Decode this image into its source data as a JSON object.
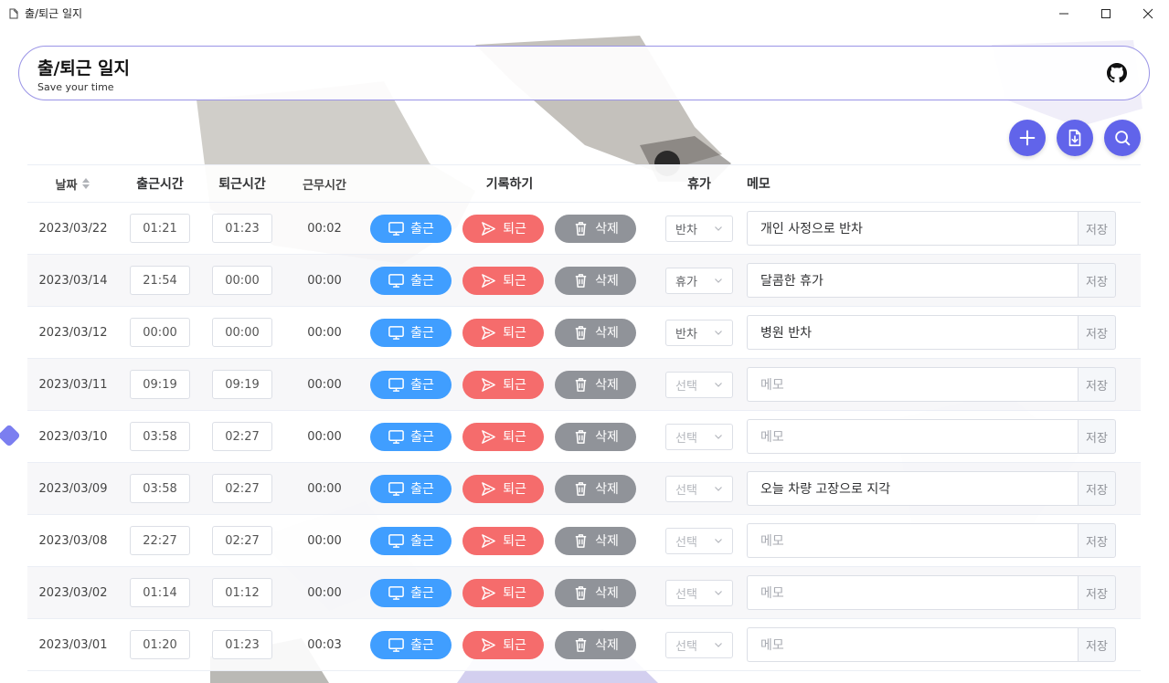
{
  "window": {
    "title": "출/퇴근 일지"
  },
  "header": {
    "title": "출/퇴근 일지",
    "subtitle": "Save your time"
  },
  "actions": {
    "add": "plus-icon",
    "export": "file-download-icon",
    "search": "search-icon"
  },
  "colors": {
    "accent": "#6164ea",
    "clock_in": "#409eff",
    "clock_out": "#f56c6c",
    "delete": "#909399"
  },
  "table": {
    "headers": {
      "date": "날짜",
      "clock_in": "출근시간",
      "clock_out": "퇴근시간",
      "work": "근무시간",
      "record": "기록하기",
      "leave": "휴가",
      "memo": "메모"
    },
    "labels": {
      "clock_in": "출근",
      "clock_out": "퇴근",
      "delete": "삭제",
      "save": "저장",
      "select_placeholder": "선택",
      "memo_placeholder": "메모"
    },
    "rows": [
      {
        "date": "2023/03/22",
        "in": "01:21",
        "out": "01:23",
        "work": "00:02",
        "leave": "반차",
        "memo": "개인 사정으로 반차"
      },
      {
        "date": "2023/03/14",
        "in": "21:54",
        "out": "00:00",
        "work": "00:00",
        "leave": "휴가",
        "memo": "달콤한 휴가"
      },
      {
        "date": "2023/03/12",
        "in": "00:00",
        "out": "00:00",
        "work": "00:00",
        "leave": "반차",
        "memo": "병원 반차"
      },
      {
        "date": "2023/03/11",
        "in": "09:19",
        "out": "09:19",
        "work": "00:00",
        "leave": "",
        "memo": ""
      },
      {
        "date": "2023/03/10",
        "in": "03:58",
        "out": "02:27",
        "work": "00:00",
        "leave": "",
        "memo": ""
      },
      {
        "date": "2023/03/09",
        "in": "03:58",
        "out": "02:27",
        "work": "00:00",
        "leave": "",
        "memo": "오늘 차량 고장으로 지각"
      },
      {
        "date": "2023/03/08",
        "in": "22:27",
        "out": "02:27",
        "work": "00:00",
        "leave": "",
        "memo": ""
      },
      {
        "date": "2023/03/02",
        "in": "01:14",
        "out": "01:12",
        "work": "00:00",
        "leave": "",
        "memo": ""
      },
      {
        "date": "2023/03/01",
        "in": "01:20",
        "out": "01:23",
        "work": "00:03",
        "leave": "",
        "memo": ""
      }
    ]
  }
}
